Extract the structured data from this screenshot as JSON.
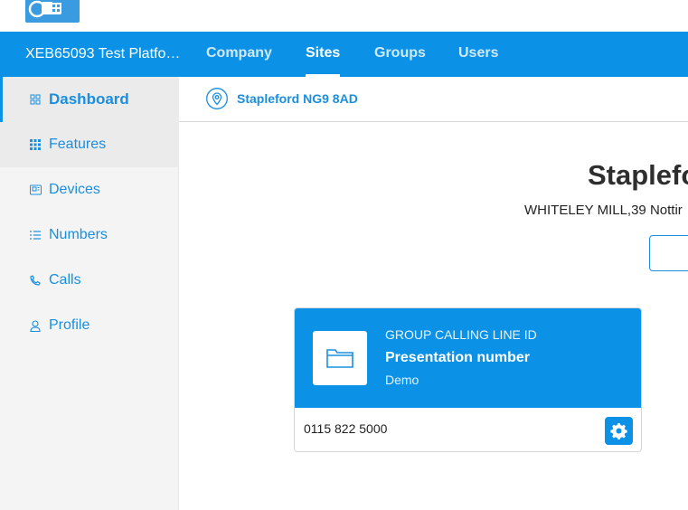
{
  "header": {
    "platform_name": "XEB65093 Test Platfo…",
    "tabs": [
      {
        "label": "Company",
        "active": false
      },
      {
        "label": "Sites",
        "active": true
      },
      {
        "label": "Groups",
        "active": false
      },
      {
        "label": "Users",
        "active": false
      }
    ]
  },
  "sidebar": {
    "items": [
      {
        "label": "Dashboard",
        "icon": "grid-icon",
        "active": true
      },
      {
        "label": "Features",
        "icon": "dots-grid-icon",
        "active": false
      },
      {
        "label": "Devices",
        "icon": "device-icon",
        "active": false
      },
      {
        "label": "Numbers",
        "icon": "list-icon",
        "active": false
      },
      {
        "label": "Calls",
        "icon": "phone-icon",
        "active": false
      },
      {
        "label": "Profile",
        "icon": "user-icon",
        "active": false
      }
    ]
  },
  "breadcrumb": {
    "location": "Stapleford NG9 8AD"
  },
  "site": {
    "title": "Staplefo",
    "address": "WHITELEY MILL,39 Nottir"
  },
  "card": {
    "label": "GROUP CALLING LINE ID",
    "title": "Presentation number",
    "subtitle": "Demo",
    "number": "0115 822 5000"
  },
  "colors": {
    "accent": "#0b92e6",
    "link": "#1a8fe0",
    "sidebar_bg": "#f4f4f4"
  }
}
